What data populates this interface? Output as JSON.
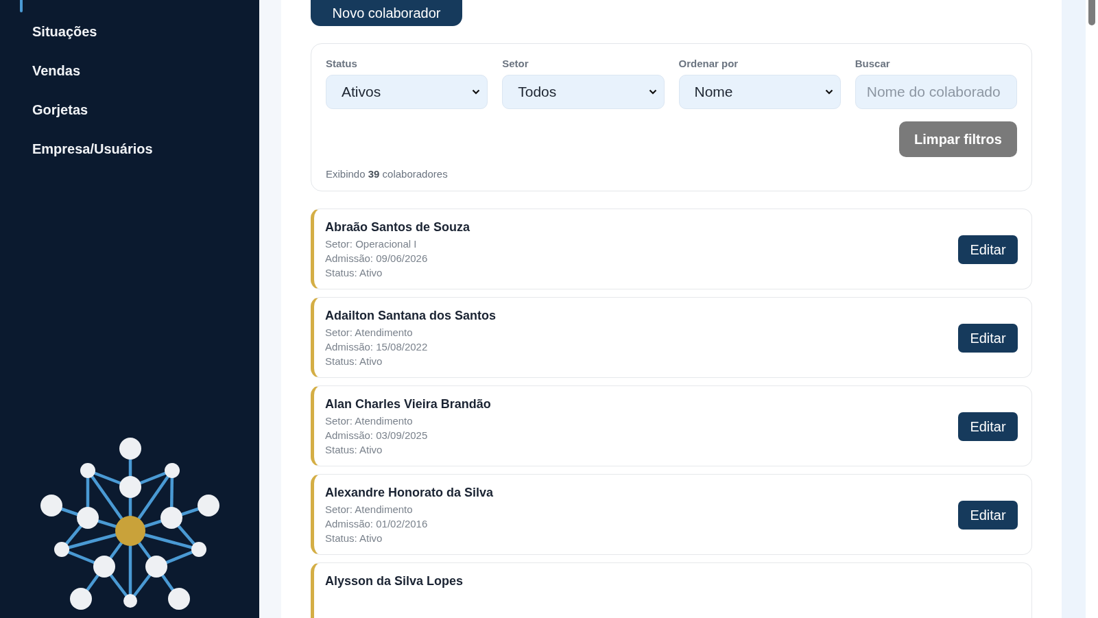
{
  "sidebar": {
    "items": [
      {
        "label": "Situações"
      },
      {
        "label": "Vendas"
      },
      {
        "label": "Gorjetas"
      },
      {
        "label": "Empresa/Usuários"
      }
    ]
  },
  "new_button": {
    "label": "Novo colaborador"
  },
  "filters": {
    "fields": [
      {
        "kind": "select",
        "label": "Status",
        "value": "Ativos"
      },
      {
        "kind": "select",
        "label": "Setor",
        "value": "Todos"
      },
      {
        "kind": "select",
        "label": "Ordenar por",
        "value": "Nome"
      },
      {
        "kind": "search",
        "label": "Buscar",
        "placeholder": "Nome do colaborado"
      }
    ],
    "clear_button": "Limpar filtros",
    "count": "Exibindo **39** colaboradores"
  },
  "employees": [
    {
      "name": "Abraão Santos de Souza",
      "sector": "Setor: Operacional I",
      "admission": "Admissão: 09/06/2026",
      "status": "Status: Ativo",
      "action": "Editar"
    },
    {
      "name": "Adailton Santana dos Santos",
      "sector": "Setor: Atendimento",
      "admission": "Admissão: 15/08/2022",
      "status": "Status: Ativo",
      "action": "Editar"
    },
    {
      "name": "Alan Charles Vieira Brandão",
      "sector": "Setor: Atendimento",
      "admission": "Admissão: 03/09/2025",
      "status": "Status: Ativo",
      "action": "Editar"
    },
    {
      "name": "Alexandre Honorato da Silva",
      "sector": "Setor: Atendimento",
      "admission": "Admissão: 01/02/2016",
      "status": "Status: Ativo",
      "action": "Editar"
    },
    {
      "name": "Alysson da Silva Lopes"
    }
  ]
}
